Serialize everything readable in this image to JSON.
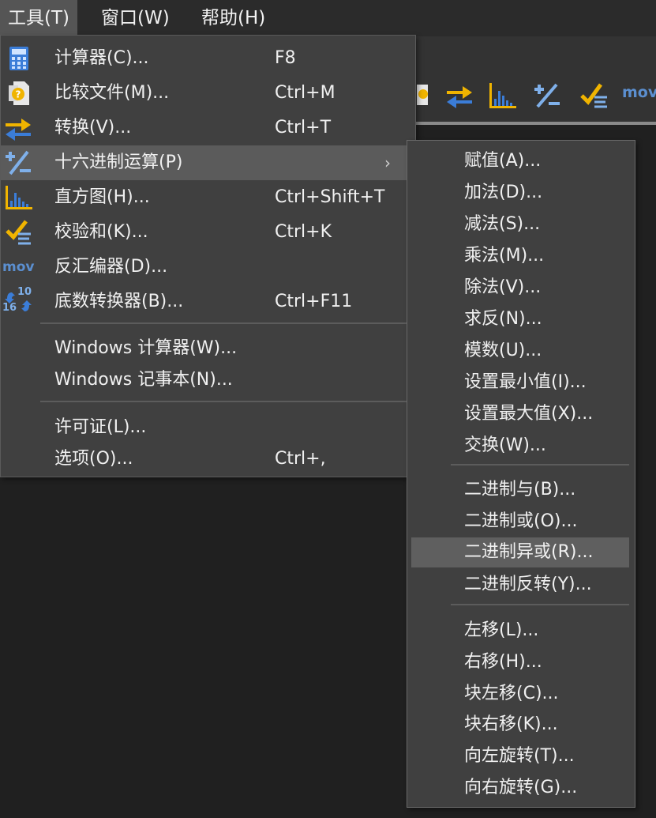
{
  "menubar": {
    "items": [
      "工具(T)",
      "窗口(W)",
      "帮助(H)"
    ]
  },
  "toolbar": {
    "mov_label": "mov"
  },
  "tools_menu": {
    "items": [
      {
        "label": "计算器(C)...",
        "shortcut": "F8",
        "icon": "calculator-icon"
      },
      {
        "label": "比较文件(M)...",
        "shortcut": "Ctrl+M",
        "icon": "compare-files-icon"
      },
      {
        "label": "转换(V)...",
        "shortcut": "Ctrl+T",
        "icon": "convert-arrows-icon"
      },
      {
        "label": "十六进制运算(P)",
        "shortcut": "",
        "icon": "hex-operations-icon",
        "has_submenu": true,
        "highlighted": true
      },
      {
        "label": "直方图(H)...",
        "shortcut": "Ctrl+Shift+T",
        "icon": "histogram-icon"
      },
      {
        "label": "校验和(K)...",
        "shortcut": "Ctrl+K",
        "icon": "checksum-icon"
      },
      {
        "label": "反汇编器(D)...",
        "shortcut": "",
        "icon": "disassembler-icon",
        "icon_text": "mov"
      },
      {
        "label": "底数转换器(B)...",
        "shortcut": "Ctrl+F11",
        "icon": "base-converter-icon",
        "icon_text_top": "10",
        "icon_text_bottom": "16"
      },
      {
        "label": "Windows 计算器(W)...",
        "shortcut": ""
      },
      {
        "label": "Windows 记事本(N)...",
        "shortcut": ""
      },
      {
        "label": "许可证(L)...",
        "shortcut": ""
      },
      {
        "label": "选项(O)...",
        "shortcut": "Ctrl+,"
      }
    ],
    "submenu_arrow": "›"
  },
  "hex_submenu": {
    "items": [
      "赋值(A)...",
      "加法(D)...",
      "减法(S)...",
      "乘法(M)...",
      "除法(V)...",
      "求反(N)...",
      "模数(U)...",
      "设置最小值(I)...",
      "设置最大值(X)...",
      "交换(W)...",
      "二进制与(B)...",
      "二进制或(O)...",
      "二进制异或(R)...",
      "二进制反转(Y)...",
      "左移(L)...",
      "右移(H)...",
      "块左移(C)...",
      "块右移(K)...",
      "向左旋转(T)...",
      "向右旋转(G)..."
    ],
    "highlighted_item": "二进制异或(R)..."
  },
  "colors": {
    "menu_bg": "#404040",
    "highlight": "#5b5b5b",
    "icon_blue": "#3b7dd8",
    "icon_yellow": "#f0b400"
  }
}
